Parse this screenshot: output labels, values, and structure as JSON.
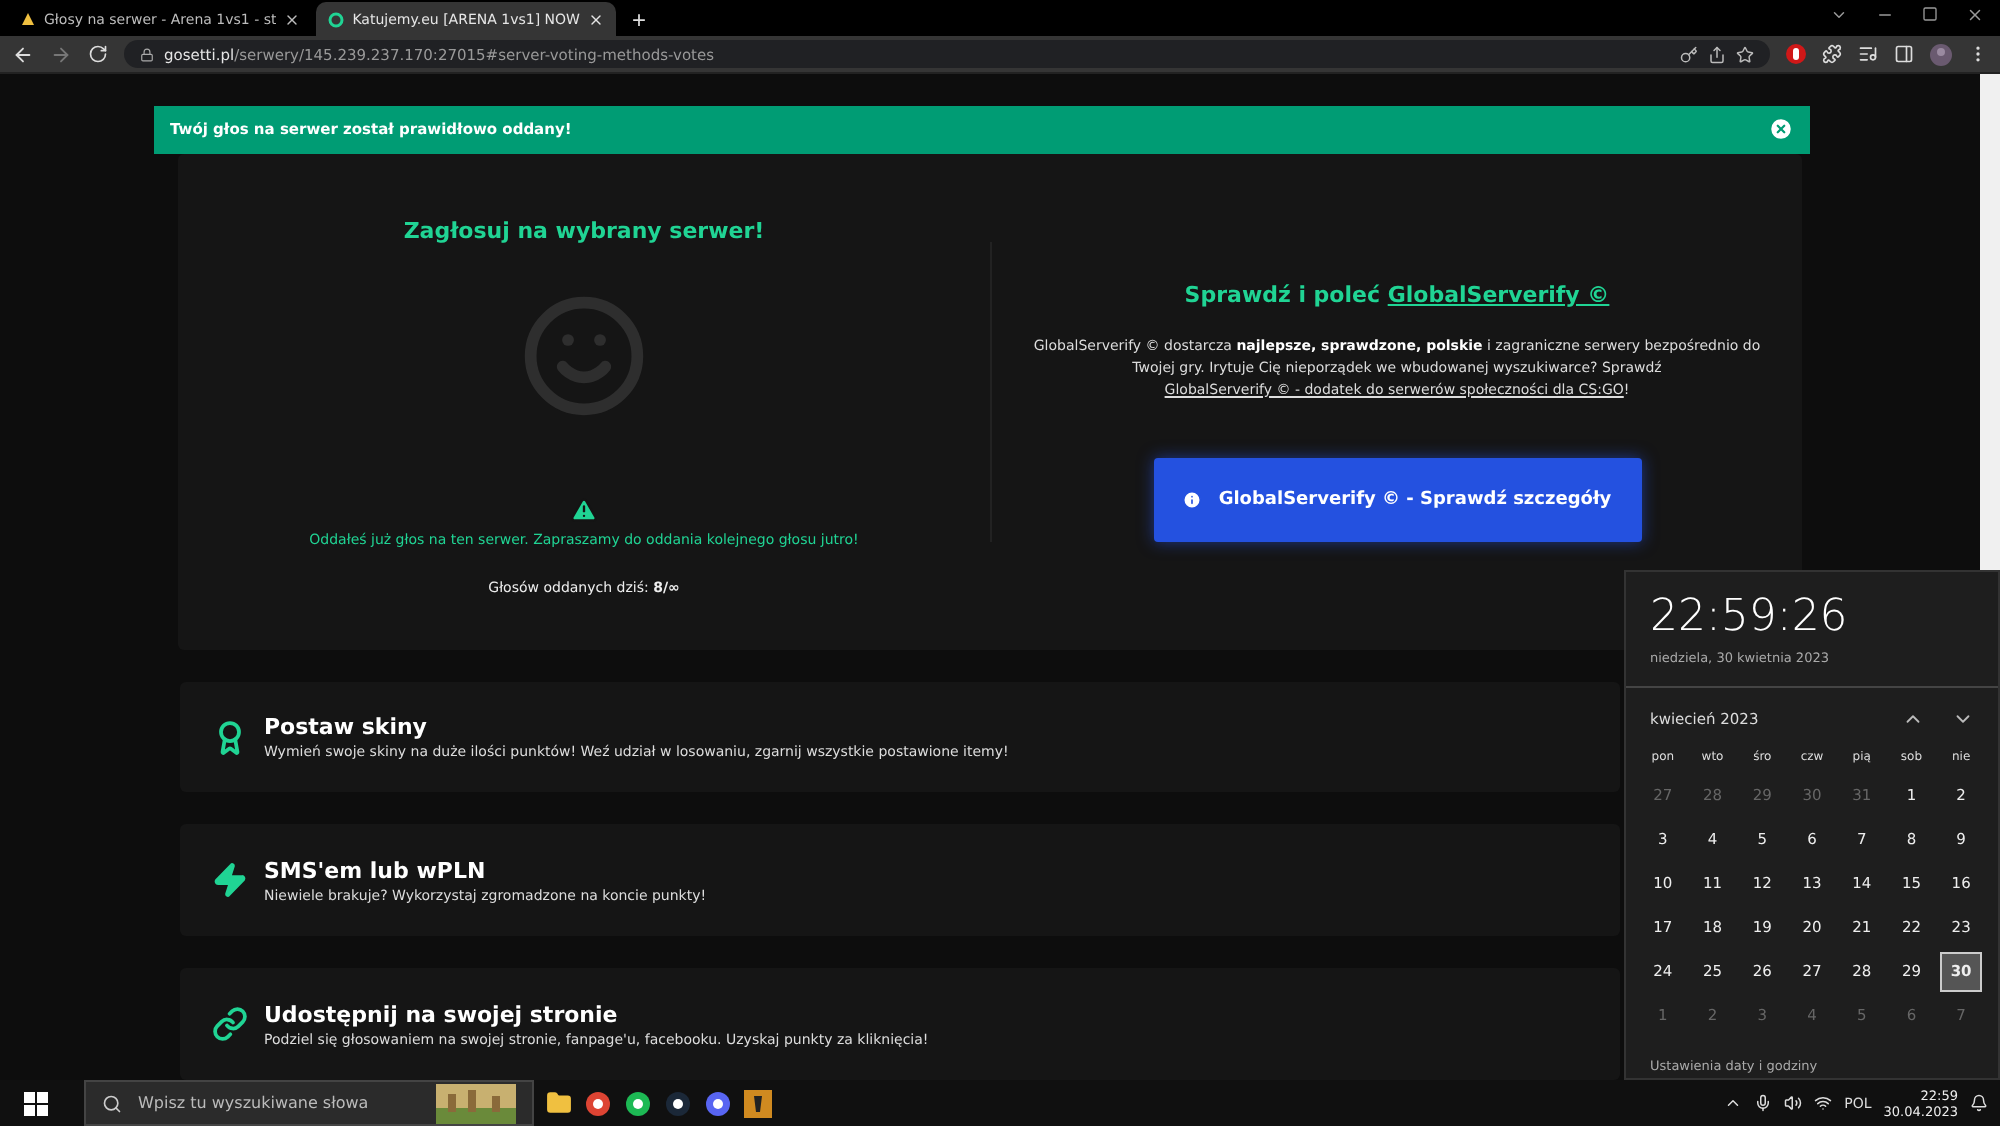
{
  "browser": {
    "tabs": [
      {
        "title": "Głosy na serwer - Arena 1vs1 - st",
        "selected": false
      },
      {
        "title": "Katujemy.eu [ARENA 1vs1] NOW",
        "selected": true
      }
    ],
    "new_tab": "+",
    "address": {
      "host": "gosetti.pl",
      "path": "/serwery/145.239.237.170:27015#server-voting-methods-votes"
    }
  },
  "alert": {
    "message": "Twój głos na serwer został prawidłowo oddany!"
  },
  "vote": {
    "title": "Zagłosuj na wybrany serwer!",
    "notice": "Oddałeś już głos na ten serwer. Zapraszamy do oddania kolejnego głosu jutro!",
    "count_label": "Głosów oddanych dziś:",
    "count": "8/∞"
  },
  "promo": {
    "title": "Sprawdź i poleć",
    "title_link": "GlobalServerify ©",
    "text_before": "GlobalServerify © dostarcza **najlepsze, sprawdzone, polskie** i zagraniczne serwery bezpośrednio do Twojej gry. Irytuje Cię nieporządek we wbudowanej wyszukiwarce? Sprawdź",
    "link": "GlobalServerify © - dodatek do serwerów społeczności dla CS:GO",
    "text_after": "!",
    "button": "GlobalServerify © - Sprawdź szczegóły"
  },
  "methods": [
    {
      "kind": "award",
      "title": "Postaw skiny",
      "description": "Wymień swoje skiny na duże ilości punktów! Weź udział w losowaniu, zgarnij wszystkie postawione itemy!"
    },
    {
      "kind": "bolt",
      "title": "SMS'em lub wPLN",
      "description": "Niewiele brakuje? Wykorzystaj zgromadzone na koncie punkty!"
    },
    {
      "kind": "link",
      "title": "Udostępnij na swojej stronie",
      "description": "Podziel się głosowaniem na swojej stronie, fanpage'u, facebooku. Uzyskaj punkty za kliknięcia!"
    }
  ],
  "clock": {
    "time": "22:59:26",
    "date": "niedziela, 30 kwietnia 2023",
    "month": "kwiecień 2023",
    "weekdays": [
      "pon",
      "wto",
      "śro",
      "czw",
      "pią",
      "sob",
      "nie"
    ],
    "days": [
      {
        "label": "27",
        "muted": true,
        "selected": false
      },
      {
        "label": "28",
        "muted": true,
        "selected": false
      },
      {
        "label": "29",
        "muted": true,
        "selected": false
      },
      {
        "label": "30",
        "muted": true,
        "selected": false
      },
      {
        "label": "31",
        "muted": true,
        "selected": false
      },
      {
        "label": "1",
        "muted": false,
        "selected": false
      },
      {
        "label": "2",
        "muted": false,
        "selected": false
      },
      {
        "label": "3",
        "muted": false,
        "selected": false
      },
      {
        "label": "4",
        "muted": false,
        "selected": false
      },
      {
        "label": "5",
        "muted": false,
        "selected": false
      },
      {
        "label": "6",
        "muted": false,
        "selected": false
      },
      {
        "label": "7",
        "muted": false,
        "selected": false
      },
      {
        "label": "8",
        "muted": false,
        "selected": false
      },
      {
        "label": "9",
        "muted": false,
        "selected": false
      },
      {
        "label": "10",
        "muted": false,
        "selected": false
      },
      {
        "label": "11",
        "muted": false,
        "selected": false
      },
      {
        "label": "12",
        "muted": false,
        "selected": false
      },
      {
        "label": "13",
        "muted": false,
        "selected": false
      },
      {
        "label": "14",
        "muted": false,
        "selected": false
      },
      {
        "label": "15",
        "muted": false,
        "selected": false
      },
      {
        "label": "16",
        "muted": false,
        "selected": false
      },
      {
        "label": "17",
        "muted": false,
        "selected": false
      },
      {
        "label": "18",
        "muted": false,
        "selected": false
      },
      {
        "label": "19",
        "muted": false,
        "selected": false
      },
      {
        "label": "20",
        "muted": false,
        "selected": false
      },
      {
        "label": "21",
        "muted": false,
        "selected": false
      },
      {
        "label": "22",
        "muted": false,
        "selected": false
      },
      {
        "label": "23",
        "muted": false,
        "selected": false
      },
      {
        "label": "24",
        "muted": false,
        "selected": false
      },
      {
        "label": "25",
        "muted": false,
        "selected": false
      },
      {
        "label": "26",
        "muted": false,
        "selected": false
      },
      {
        "label": "27",
        "muted": false,
        "selected": false
      },
      {
        "label": "28",
        "muted": false,
        "selected": false
      },
      {
        "label": "29",
        "muted": false,
        "selected": false
      },
      {
        "label": "30",
        "muted": false,
        "selected": true
      },
      {
        "label": "1",
        "muted": true,
        "selected": false
      },
      {
        "label": "2",
        "muted": true,
        "selected": false
      },
      {
        "label": "3",
        "muted": true,
        "selected": false
      },
      {
        "label": "4",
        "muted": true,
        "selected": false
      },
      {
        "label": "5",
        "muted": true,
        "selected": false
      },
      {
        "label": "6",
        "muted": true,
        "selected": false
      },
      {
        "label": "7",
        "muted": true,
        "selected": false
      }
    ],
    "settings_link": "Ustawienia daty i godziny"
  },
  "taskbar": {
    "search": {
      "placeholder": "Wpisz tu wyszukiwane słowa"
    },
    "language": "POL",
    "time": "22:59",
    "date": "30.04.2023"
  }
}
